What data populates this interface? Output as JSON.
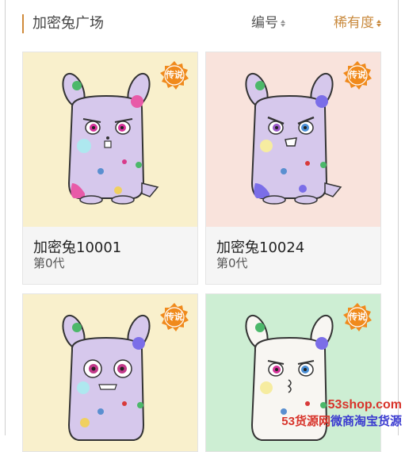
{
  "header": {
    "title": "加密兔广场",
    "sort_number": "编号",
    "sort_rarity": "稀有度"
  },
  "cards": [
    {
      "name": "加密兔10001",
      "generation": "第0代",
      "badge": "传说",
      "bg": "#f9f0cc",
      "body": "#d6c8ec",
      "eyes": "pink"
    },
    {
      "name": "加密兔10024",
      "generation": "第0代",
      "badge": "传说",
      "bg": "#f9e3dc",
      "body": "#d6c8ec",
      "eyes": "angry"
    },
    {
      "name": "",
      "generation": "",
      "badge": "传说",
      "bg": "#f9f0cc",
      "body": "#d6c8ec",
      "eyes": "round"
    },
    {
      "name": "",
      "generation": "",
      "badge": "传说",
      "bg": "#cdeed3",
      "body": "#f8f6f2",
      "eyes": "blue"
    }
  ],
  "watermark": {
    "url": "53shop.com",
    "brand_num": "53",
    "brand_red": "货源网",
    "brand_blue": "微商淘宝货源"
  },
  "colors": {
    "accent": "#d08a3a",
    "badge": "#f08a1c"
  }
}
